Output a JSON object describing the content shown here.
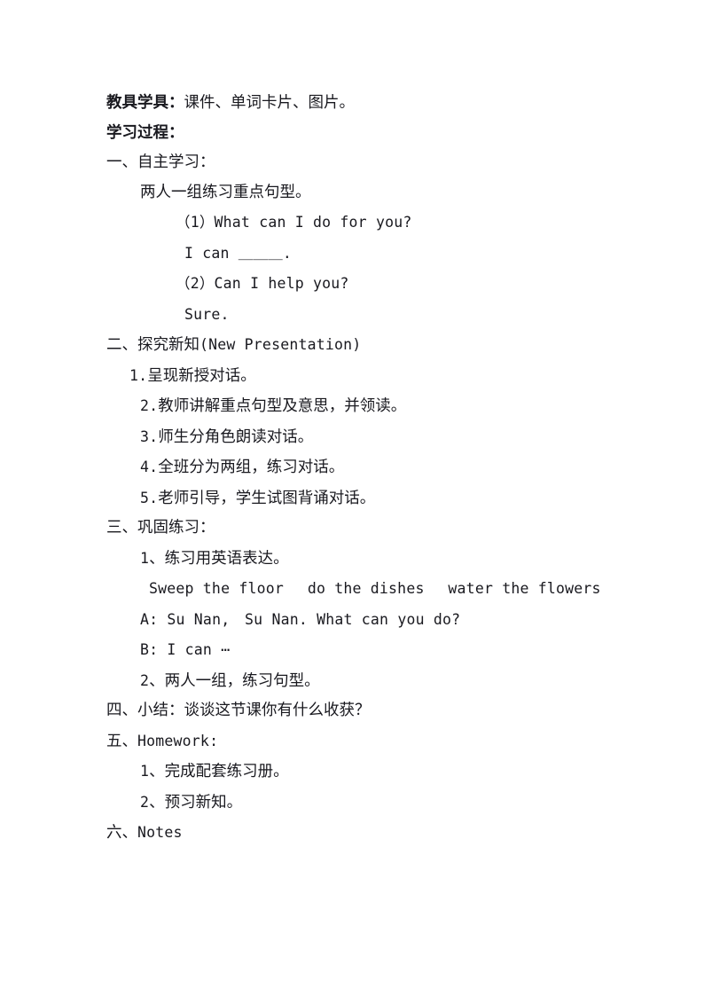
{
  "document": {
    "type": "lesson-plan",
    "page_background": "#ffffff",
    "text_color": "#19191f",
    "lines": [
      {
        "id": "teaching-aids",
        "indent": "i0",
        "bold_prefix": "教具学具：",
        "text": "课件、单词卡片、图片。"
      },
      {
        "id": "learning-process",
        "indent": "i0",
        "text": "学习过程："
      },
      {
        "id": "section-one",
        "indent": "i0",
        "text": "一、自主学习："
      },
      {
        "id": "pair-practice",
        "indent": "i2",
        "text": "两人一组练习重点句型。"
      },
      {
        "id": "q1",
        "indent": "i5",
        "text": "（1）What can I do for you?"
      },
      {
        "id": "a1",
        "indent": "i6",
        "text": "I can ＿＿＿."
      },
      {
        "id": "q2",
        "indent": "i5",
        "text": "（2）Can I help you?"
      },
      {
        "id": "a2",
        "indent": "i6",
        "text": "Sure."
      },
      {
        "id": "section-two",
        "indent": "i0",
        "text": "二、探究新知(New Presentation)"
      },
      {
        "id": "step-1",
        "indent": "i1",
        "text": "1.呈现新授对话。"
      },
      {
        "id": "step-2",
        "indent": "i2",
        "text": "2.教师讲解重点句型及意思，并领读。"
      },
      {
        "id": "step-3",
        "indent": "i2",
        "text": "3.师生分角色朗读对话。"
      },
      {
        "id": "step-4",
        "indent": "i2",
        "text": "4.全班分为两组，练习对话。"
      },
      {
        "id": "step-5",
        "indent": "i2",
        "text": "5.老师引导，学生试图背诵对话。"
      },
      {
        "id": "section-three",
        "indent": "i0",
        "text": "三、巩固练习："
      },
      {
        "id": "consolidate-1",
        "indent": "i2",
        "text": "1、练习用英语表达。"
      },
      {
        "id": "phrase-row",
        "indent": "i3",
        "text": "Sweep the floor　 do the dishes　 water the flowers"
      },
      {
        "id": "dialogue-a",
        "indent": "i2",
        "text": "A: Su Nan,　Su Nan. What can you do?"
      },
      {
        "id": "dialogue-b",
        "indent": "i2",
        "text": "B: I can ⋯"
      },
      {
        "id": "consolidate-2",
        "indent": "i2",
        "text": "2、两人一组，练习句型。"
      },
      {
        "id": "section-four",
        "indent": "i0",
        "text": "四、小结：谈谈这节课你有什么收获？"
      },
      {
        "id": "section-five",
        "indent": "i0",
        "text": "五、Homework:"
      },
      {
        "id": "homework-1",
        "indent": "i2",
        "text": "1、完成配套练习册。"
      },
      {
        "id": "homework-2",
        "indent": "i2",
        "text": "2、预习新知。"
      },
      {
        "id": "section-six",
        "indent": "i0",
        "text": "六、Notes"
      }
    ]
  }
}
